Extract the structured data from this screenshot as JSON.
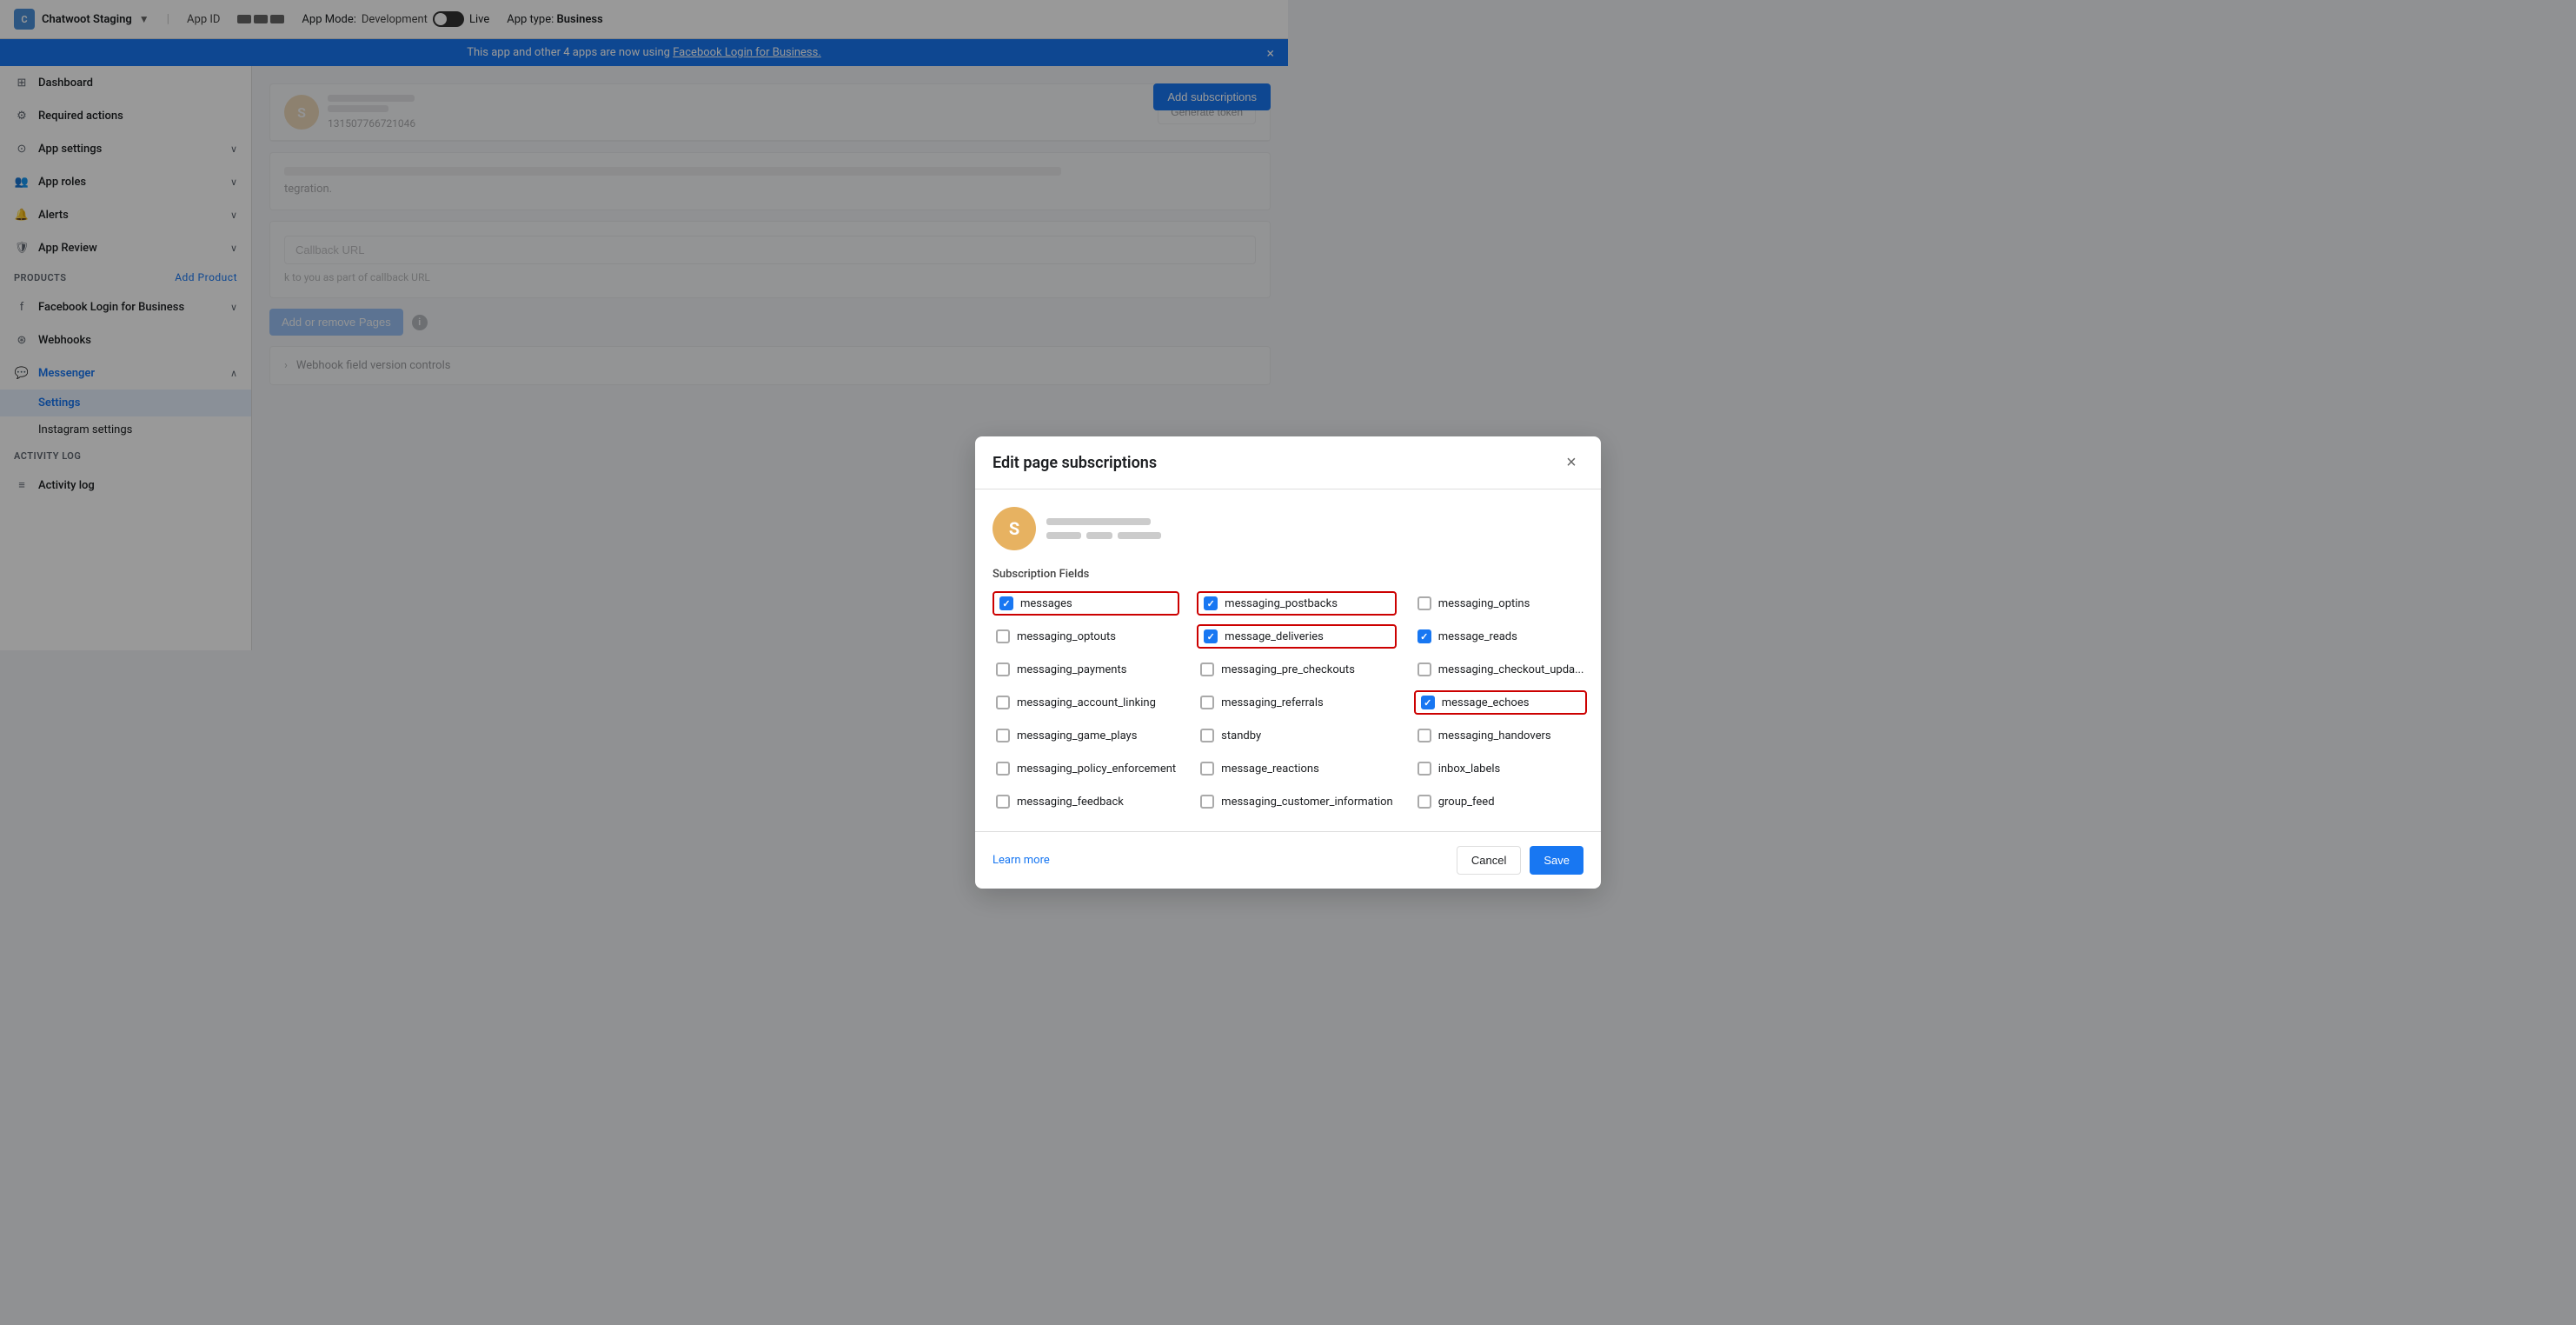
{
  "topbar": {
    "app_name": "Chatwoot Staging",
    "app_id_label": "App ID",
    "app_mode_label": "App Mode:",
    "app_mode_value": "Development",
    "live_label": "Live",
    "app_type_label": "App type:",
    "app_type_value": "Business",
    "generate_token_label": "Generate token"
  },
  "banner": {
    "text": "This app and other 4 apps are now using ",
    "link_text": "Facebook Login for Business.",
    "close": "×"
  },
  "sidebar": {
    "dashboard_label": "Dashboard",
    "required_actions_label": "Required actions",
    "app_settings_label": "App settings",
    "app_roles_label": "App roles",
    "alerts_label": "Alerts",
    "app_review_label": "App Review",
    "products_label": "Products",
    "add_product_label": "Add Product",
    "facebook_login_label": "Facebook Login for Business",
    "webhooks_label": "Webhooks",
    "messenger_label": "Messenger",
    "settings_label": "Settings",
    "instagram_settings_label": "Instagram settings",
    "activity_log_section": "Activity log",
    "activity_log_label": "Activity log"
  },
  "modal": {
    "title": "Edit page subscriptions",
    "close_label": "×",
    "account_avatar": "S",
    "subscription_fields_label": "Subscription Fields",
    "fields": [
      {
        "id": "messages",
        "label": "messages",
        "checked": true,
        "highlighted": true,
        "col": 0
      },
      {
        "id": "messaging_postbacks",
        "label": "messaging_postbacks",
        "checked": true,
        "highlighted": true,
        "col": 1
      },
      {
        "id": "messaging_optins",
        "label": "messaging_optins",
        "checked": false,
        "highlighted": false,
        "col": 2
      },
      {
        "id": "messaging_optouts",
        "label": "messaging_optouts",
        "checked": false,
        "highlighted": false,
        "col": 0
      },
      {
        "id": "message_deliveries",
        "label": "message_deliveries",
        "checked": true,
        "highlighted": true,
        "col": 1
      },
      {
        "id": "message_reads",
        "label": "message_reads",
        "checked": true,
        "highlighted": false,
        "col": 2
      },
      {
        "id": "messaging_payments",
        "label": "messaging_payments",
        "checked": false,
        "highlighted": false,
        "col": 0
      },
      {
        "id": "messaging_pre_checkouts",
        "label": "messaging_pre_checkouts",
        "checked": false,
        "highlighted": false,
        "col": 1
      },
      {
        "id": "messaging_checkout_updates",
        "label": "messaging_checkout_upda...",
        "checked": false,
        "highlighted": false,
        "col": 2
      },
      {
        "id": "messaging_account_linking",
        "label": "messaging_account_linking",
        "checked": false,
        "highlighted": false,
        "col": 0
      },
      {
        "id": "messaging_referrals",
        "label": "messaging_referrals",
        "checked": false,
        "highlighted": false,
        "col": 1
      },
      {
        "id": "message_echoes",
        "label": "message_echoes",
        "checked": true,
        "highlighted": true,
        "col": 2
      },
      {
        "id": "messaging_game_plays",
        "label": "messaging_game_plays",
        "checked": false,
        "highlighted": false,
        "col": 0
      },
      {
        "id": "standby",
        "label": "standby",
        "checked": false,
        "highlighted": false,
        "col": 1
      },
      {
        "id": "messaging_handovers",
        "label": "messaging_handovers",
        "checked": false,
        "highlighted": false,
        "col": 2
      },
      {
        "id": "messaging_policy_enforcement",
        "label": "messaging_policy_enforcement",
        "checked": false,
        "highlighted": false,
        "col": 0
      },
      {
        "id": "message_reactions",
        "label": "message_reactions",
        "checked": false,
        "highlighted": false,
        "col": 1
      },
      {
        "id": "inbox_labels",
        "label": "inbox_labels",
        "checked": false,
        "highlighted": false,
        "col": 2
      },
      {
        "id": "messaging_feedback",
        "label": "messaging_feedback",
        "checked": false,
        "highlighted": false,
        "col": 0
      },
      {
        "id": "messaging_customer_information",
        "label": "messaging_customer_information",
        "checked": false,
        "highlighted": false,
        "col": 1
      },
      {
        "id": "group_feed",
        "label": "group_feed",
        "checked": false,
        "highlighted": false,
        "col": 2
      }
    ],
    "learn_more_label": "Learn more",
    "cancel_label": "Cancel",
    "save_label": "Save"
  },
  "main": {
    "add_subscriptions_label": "Add subscriptions",
    "add_pages_label": "Add or remove Pages",
    "webhook_label": "Webhook field version controls",
    "callback_url_text": "k to you as part of callback URL",
    "integration_text": "tegration."
  },
  "colors": {
    "primary": "#1877f2",
    "danger": "#cc0000",
    "text_muted": "#606770"
  }
}
